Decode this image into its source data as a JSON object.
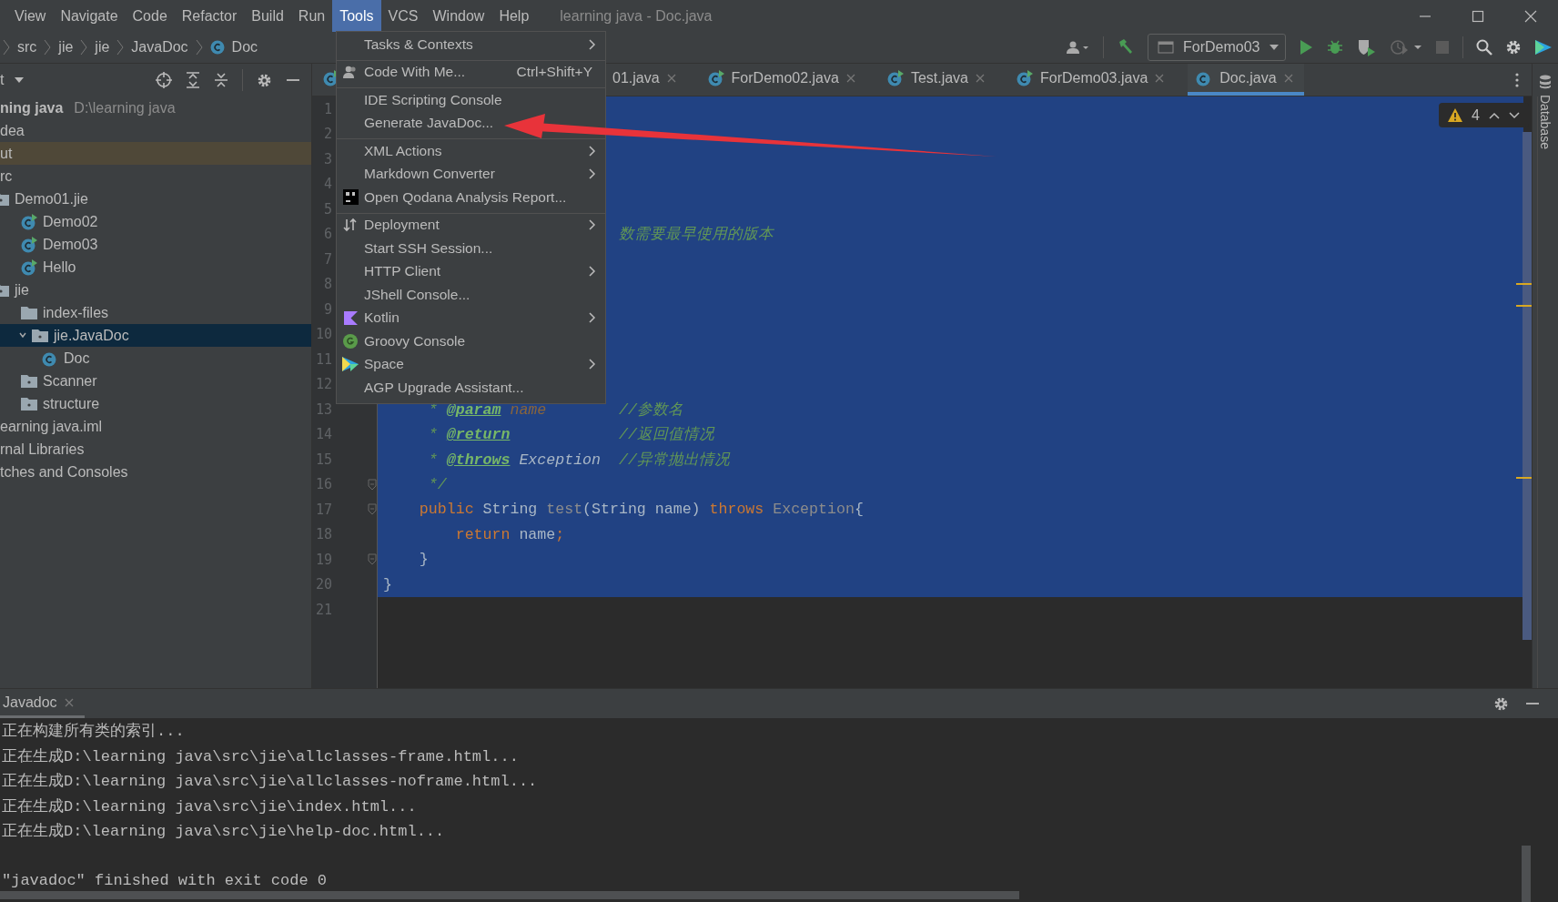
{
  "menu_bar": {
    "items": [
      {
        "label": "View",
        "selected": false
      },
      {
        "label": "Navigate",
        "selected": false
      },
      {
        "label": "Code",
        "selected": false
      },
      {
        "label": "Refactor",
        "selected": false
      },
      {
        "label": "Build",
        "selected": false
      },
      {
        "label": "Run",
        "selected": false
      },
      {
        "label": "Tools",
        "selected": true
      },
      {
        "label": "VCS",
        "selected": false
      },
      {
        "label": "Window",
        "selected": false
      },
      {
        "label": "Help",
        "selected": false
      }
    ],
    "title": "learning java - Doc.java"
  },
  "breadcrumbs": [
    "src",
    "jie",
    "jie",
    "JavaDoc",
    "Doc"
  ],
  "run_config": "ForDemo03",
  "project_panel": {
    "title": "t",
    "tree": [
      {
        "label": "ning java",
        "path": "D:\\learning java",
        "selected": false,
        "highlighted": false,
        "children": [
          {
            "label": "dea",
            "selected": false,
            "highlighted": false
          },
          {
            "label": "ut",
            "selected": false,
            "highlighted": true
          },
          {
            "label": "rc",
            "selected": false,
            "highlighted": false,
            "children": [
              {
                "label": "Demo01.jie",
                "kind": "package",
                "selected": false,
                "highlighted": false,
                "children": [
                  {
                    "label": "Demo02",
                    "kind": "runnable",
                    "selected": false,
                    "highlighted": false
                  },
                  {
                    "label": "Demo03",
                    "kind": "runnable",
                    "selected": false,
                    "highlighted": false
                  },
                  {
                    "label": "Hello",
                    "kind": "runnable",
                    "selected": false,
                    "highlighted": false
                  }
                ]
              },
              {
                "label": "jie",
                "kind": "package",
                "selected": false,
                "highlighted": false,
                "children": [
                  {
                    "label": "index-files",
                    "kind": "folder",
                    "selected": false,
                    "highlighted": false
                  },
                  {
                    "label": "jie.JavaDoc",
                    "kind": "package",
                    "selected": true,
                    "highlighted": false,
                    "children": [
                      {
                        "label": "Doc",
                        "kind": "class",
                        "selected": false,
                        "highlighted": false
                      }
                    ]
                  },
                  {
                    "label": "Scanner",
                    "kind": "package",
                    "selected": false,
                    "highlighted": false
                  },
                  {
                    "label": "structure",
                    "kind": "package",
                    "selected": false,
                    "highlighted": false
                  }
                ]
              }
            ]
          },
          {
            "label": "earning java.iml",
            "selected": false,
            "highlighted": false
          }
        ]
      },
      {
        "label": "rnal Libraries",
        "selected": false,
        "highlighted": false
      },
      {
        "label": "tches and Consoles",
        "selected": false,
        "highlighted": false
      }
    ]
  },
  "tabs": [
    {
      "label": "01.java",
      "selected": false
    },
    {
      "label": "ForDemo02.java",
      "selected": false
    },
    {
      "label": "Test.java",
      "selected": false
    },
    {
      "label": "ForDemo03.java",
      "selected": false
    },
    {
      "label": "Doc.java",
      "selected": true
    }
  ],
  "editor": {
    "warnings": "4",
    "lines": [
      {
        "number": "1",
        "selected": true
      },
      {
        "number": "2",
        "selected": true
      },
      {
        "number": "3",
        "selected": true
      },
      {
        "number": "4",
        "selected": true
      },
      {
        "number": "5",
        "selected": true
      },
      {
        "number": "6",
        "selected": true,
        "tokens": [
          {
            "text": "                          数需要最早使用的版本",
            "kind": "doc"
          }
        ]
      },
      {
        "number": "7",
        "selected": true
      },
      {
        "number": "8",
        "selected": true
      },
      {
        "number": "9",
        "selected": true
      },
      {
        "number": "10",
        "selected": true
      },
      {
        "number": "11",
        "selected": true
      },
      {
        "number": "12",
        "selected": true
      },
      {
        "number": "13",
        "selected": true,
        "tokens": [
          {
            "text": "     * ",
            "kind": "doc"
          },
          {
            "text": "@param",
            "kind": "tag"
          },
          {
            "text": " name",
            "kind": "param"
          },
          {
            "text": "        //参数名",
            "kind": "doc"
          }
        ]
      },
      {
        "number": "14",
        "selected": true,
        "tokens": [
          {
            "text": "     * ",
            "kind": "doc"
          },
          {
            "text": "@return",
            "kind": "tag"
          },
          {
            "text": "            //返回值情况",
            "kind": "doc"
          }
        ]
      },
      {
        "number": "15",
        "selected": true,
        "tokens": [
          {
            "text": "     * ",
            "kind": "doc"
          },
          {
            "text": "@throws",
            "kind": "tag"
          },
          {
            "text": " Exception",
            "kind": "doc_type"
          },
          {
            "text": "  //异常抛出情况",
            "kind": "doc"
          }
        ]
      },
      {
        "number": "16",
        "selected": true,
        "tokens": [
          {
            "text": "     */",
            "kind": "doc"
          }
        ]
      },
      {
        "number": "17",
        "selected": true,
        "tokens": [
          {
            "text": "    public",
            "kind": "keyword"
          },
          {
            "text": " String ",
            "kind": "plain"
          },
          {
            "text": "test",
            "kind": "dim"
          },
          {
            "text": "(String name) ",
            "kind": "plain"
          },
          {
            "text": "throws",
            "kind": "keyword"
          },
          {
            "text": " Exception",
            "kind": "dim"
          },
          {
            "text": "{",
            "kind": "plain"
          }
        ]
      },
      {
        "number": "18",
        "selected": true,
        "tokens": [
          {
            "text": "        return",
            "kind": "keyword"
          },
          {
            "text": " name",
            "kind": "plain"
          },
          {
            "text": ";",
            "kind": "keyword"
          }
        ]
      },
      {
        "number": "19",
        "selected": true,
        "tokens": [
          {
            "text": "    }",
            "kind": "plain"
          }
        ]
      },
      {
        "number": "20",
        "selected": true,
        "tokens": [
          {
            "text": "}",
            "kind": "plain"
          }
        ]
      },
      {
        "number": "21",
        "selected": false
      }
    ]
  },
  "tools_menu": [
    {
      "label": "Tasks & Contexts",
      "submenu": true,
      "separator_before": false
    },
    {
      "label": "Code With Me...",
      "shortcut": "Ctrl+Shift+Y",
      "submenu": false,
      "separator_before": true
    },
    {
      "label": "IDE Scripting Console",
      "submenu": false,
      "separator_before": true
    },
    {
      "label": "Generate JavaDoc...",
      "submenu": false,
      "separator_before": false
    },
    {
      "label": "XML Actions",
      "submenu": true,
      "separator_before": true
    },
    {
      "label": "Markdown Converter",
      "submenu": true,
      "separator_before": false
    },
    {
      "label": "Open Qodana Analysis Report...",
      "submenu": false,
      "separator_before": false
    },
    {
      "label": "Deployment",
      "submenu": true,
      "separator_before": true
    },
    {
      "label": "Start SSH Session...",
      "submenu": false,
      "separator_before": false
    },
    {
      "label": "HTTP Client",
      "submenu": true,
      "separator_before": false
    },
    {
      "label": "JShell Console...",
      "submenu": false,
      "separator_before": false
    },
    {
      "label": "Kotlin",
      "submenu": true,
      "separator_before": false
    },
    {
      "label": "Groovy Console",
      "submenu": false,
      "separator_before": false
    },
    {
      "label": "Space",
      "submenu": true,
      "separator_before": false
    },
    {
      "label": "AGP Upgrade Assistant...",
      "submenu": false,
      "separator_before": false
    }
  ],
  "side_stripe": "Database",
  "console": {
    "tab": "Javadoc",
    "lines": [
      "正在构建所有类的索引...",
      "正在生成D:\\learning java\\src\\jie\\allclasses-frame.html...",
      "正在生成D:\\learning java\\src\\jie\\allclasses-noframe.html...",
      "正在生成D:\\learning java\\src\\jie\\index.html...",
      "正在生成D:\\learning java\\src\\jie\\help-doc.html...",
      "\"javadoc\" finished with exit code 0"
    ]
  }
}
